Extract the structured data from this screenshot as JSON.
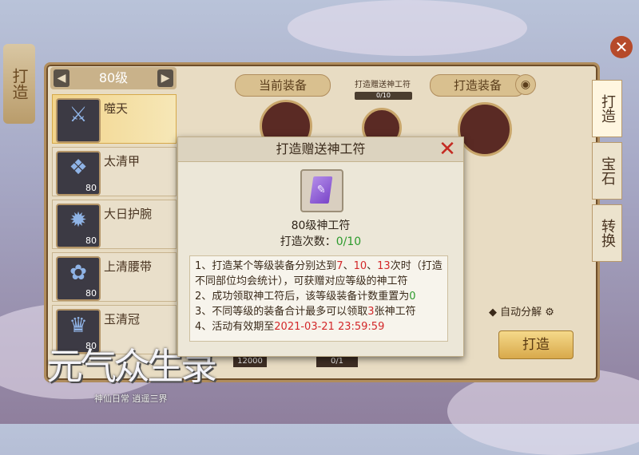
{
  "screen": {
    "level_label": "80级",
    "tab_current_equip": "当前装备",
    "tab_forge_equip": "打造装备",
    "progress_label": "打造赠送神工符",
    "progress_value": "0/10",
    "side_tabs": [
      "打造",
      "宝石",
      "转换"
    ],
    "left_banner": "打造",
    "auto_decompose_label": "自动分解",
    "forge_button": "打造",
    "bottom_values": [
      "12000",
      "0/1"
    ],
    "equipment": [
      {
        "name": "噬天",
        "level": "",
        "selected": true,
        "glyph": "⚔"
      },
      {
        "name": "太清甲",
        "level": "80",
        "selected": false,
        "glyph": "❖"
      },
      {
        "name": "大日护腕",
        "level": "80",
        "selected": false,
        "glyph": "✹"
      },
      {
        "name": "上清腰带",
        "level": "80",
        "selected": false,
        "glyph": "✿"
      },
      {
        "name": "玉清冠",
        "level": "80",
        "selected": false,
        "glyph": "♛"
      }
    ]
  },
  "modal": {
    "title": "打造赠送神工符",
    "item_name": "80级神工符",
    "count_label": "打造次数：",
    "count_value": "0/10",
    "rules": {
      "r1_a": "1、打造某个等级装备分别达到",
      "r1_n1": "7",
      "r1_sep1": "、",
      "r1_n2": "10",
      "r1_sep2": "、",
      "r1_n3": "13",
      "r1_b": "次时（打造不同部位均会统计），可获赠对应等级的神工符",
      "r2_a": "2、成功领取神工符后，该等级装备计数重置为",
      "r2_n": "0",
      "r3_a": "3、不同等级的装备合计最多可以领取",
      "r3_n": "3",
      "r3_b": "张神工符",
      "r4_a": "4、活动有效期至",
      "r4_date": "2021-03-21 23:59:59"
    }
  },
  "logo": {
    "title": "元气众生录",
    "subtitle": "神仙日常 逍遥三界"
  },
  "colors": {
    "highlight_red": "#d3282a",
    "highlight_green": "#2c9a2c",
    "frame_brown": "#b08d5d"
  }
}
